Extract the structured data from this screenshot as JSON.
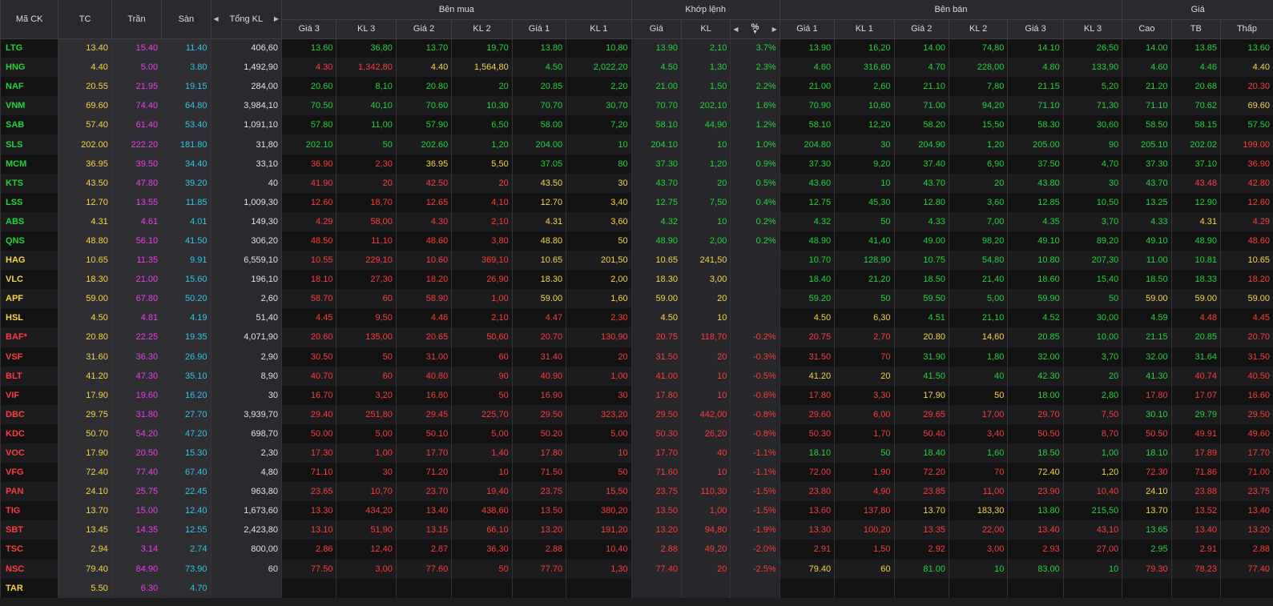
{
  "headers": {
    "symbol": "Mã CK",
    "ref": "TC",
    "ceil": "Trần",
    "floor": "Sàn",
    "total_vol": "Tổng KL",
    "buy_group": "Bên mua",
    "match_group": "Khớp lệnh",
    "sell_group": "Bên bán",
    "price_group": "Giá",
    "buy_cols": [
      "Giá 3",
      "KL 3",
      "Giá 2",
      "KL 2",
      "Giá 1",
      "KL 1"
    ],
    "match_cols": [
      "Giá",
      "KL",
      "%"
    ],
    "sell_cols": [
      "Giá 1",
      "KL 1",
      "Giá 2",
      "KL 2",
      "Giá 3",
      "KL 3"
    ],
    "price_cols": [
      "Cao",
      "TB",
      "Thấp"
    ]
  },
  "icons": {
    "left": "caret-left-icon",
    "right": "caret-right-icon",
    "sort": "sort-down-icon"
  },
  "colors": {
    "up": "#23d33c",
    "down": "#ff3b3b",
    "ref": "#f5d547",
    "ceil": "#f03cf0",
    "floor": "#2ec4f0"
  },
  "rows": [
    [
      "LTG",
      "13.40",
      "15.40",
      "11.40",
      "406,60",
      "13.60",
      "36,80",
      "13.70",
      "19,70",
      "13.80",
      "10,80",
      "13.90",
      "2,10",
      "3.7%",
      "13.90",
      "16,20",
      "14.00",
      "74,80",
      "14.10",
      "26,50",
      "14.00",
      "13.85",
      "13.60"
    ],
    [
      "HNG",
      "4.40",
      "5.00",
      "3.80",
      "1,492,90",
      "4.30",
      "1,342,80",
      "4.40",
      "1,564,80",
      "4.50",
      "2,022,20",
      "4.50",
      "1,30",
      "2.3%",
      "4.60",
      "316,60",
      "4.70",
      "228,00",
      "4.80",
      "133,90",
      "4.60",
      "4.46",
      "4.40"
    ],
    [
      "NAF",
      "20.55",
      "21.95",
      "19.15",
      "284,00",
      "20.60",
      "8,10",
      "20.80",
      "20",
      "20.85",
      "2,20",
      "21.00",
      "1,50",
      "2.2%",
      "21.00",
      "2,60",
      "21.10",
      "7,80",
      "21.15",
      "5,20",
      "21.20",
      "20.68",
      "20.30"
    ],
    [
      "VNM",
      "69.60",
      "74.40",
      "64.80",
      "3,984,10",
      "70.50",
      "40,10",
      "70.60",
      "10,30",
      "70.70",
      "30,70",
      "70.70",
      "202,10",
      "1.6%",
      "70.90",
      "10,60",
      "71.00",
      "94,20",
      "71.10",
      "71,30",
      "71.10",
      "70.62",
      "69.60"
    ],
    [
      "SAB",
      "57.40",
      "61.40",
      "53.40",
      "1,091,10",
      "57.80",
      "11,00",
      "57.90",
      "6,50",
      "58.00",
      "7,20",
      "58.10",
      "44,90",
      "1.2%",
      "58.10",
      "12,20",
      "58.20",
      "15,50",
      "58.30",
      "30,60",
      "58.50",
      "58.15",
      "57.50"
    ],
    [
      "SLS",
      "202.00",
      "222.20",
      "181.80",
      "31,80",
      "202.10",
      "50",
      "202.60",
      "1,20",
      "204.00",
      "10",
      "204.10",
      "10",
      "1.0%",
      "204.80",
      "30",
      "204.90",
      "1,20",
      "205.00",
      "90",
      "205.10",
      "202.02",
      "199.00"
    ],
    [
      "MCM",
      "36.95",
      "39.50",
      "34.40",
      "33,10",
      "36.90",
      "2,30",
      "36.95",
      "5,50",
      "37.05",
      "80",
      "37.30",
      "1,20",
      "0.9%",
      "37.30",
      "9,20",
      "37.40",
      "6,90",
      "37.50",
      "4,70",
      "37.30",
      "37.10",
      "36.90"
    ],
    [
      "KTS",
      "43.50",
      "47.80",
      "39.20",
      "40",
      "41.90",
      "20",
      "42.50",
      "20",
      "43.50",
      "30",
      "43.70",
      "20",
      "0.5%",
      "43.60",
      "10",
      "43.70",
      "20",
      "43.80",
      "30",
      "43.70",
      "43.48",
      "42.80"
    ],
    [
      "LSS",
      "12.70",
      "13.55",
      "11.85",
      "1,009,30",
      "12.60",
      "18,70",
      "12.65",
      "4,10",
      "12.70",
      "3,40",
      "12.75",
      "7,50",
      "0.4%",
      "12.75",
      "45,30",
      "12.80",
      "3,60",
      "12.85",
      "10,50",
      "13.25",
      "12.90",
      "12.60"
    ],
    [
      "ABS",
      "4.31",
      "4.61",
      "4.01",
      "149,30",
      "4.29",
      "58,00",
      "4.30",
      "2,10",
      "4.31",
      "3,60",
      "4.32",
      "10",
      "0.2%",
      "4.32",
      "50",
      "4.33",
      "7,00",
      "4.35",
      "3,70",
      "4.33",
      "4.31",
      "4.29"
    ],
    [
      "QNS",
      "48.80",
      "56.10",
      "41.50",
      "306,20",
      "48.50",
      "11,10",
      "48.60",
      "3,80",
      "48.80",
      "50",
      "48.90",
      "2,00",
      "0.2%",
      "48.90",
      "41,40",
      "49.00",
      "98,20",
      "49.10",
      "89,20",
      "49.10",
      "48.90",
      "48.60"
    ],
    [
      "HAG",
      "10.65",
      "11.35",
      "9.91",
      "6,559,10",
      "10.55",
      "229,10",
      "10.60",
      "369,10",
      "10.65",
      "201,50",
      "10.65",
      "241,50",
      "",
      "10.70",
      "128,90",
      "10.75",
      "54,80",
      "10.80",
      "207,30",
      "11.00",
      "10.81",
      "10.65"
    ],
    [
      "VLC",
      "18.30",
      "21.00",
      "15.60",
      "196,10",
      "18.10",
      "27,30",
      "18.20",
      "26,90",
      "18.30",
      "2,00",
      "18.30",
      "3,00",
      "",
      "18.40",
      "21,20",
      "18.50",
      "21,40",
      "18.60",
      "15,40",
      "18.50",
      "18.33",
      "18.20"
    ],
    [
      "APF",
      "59.00",
      "67.80",
      "50.20",
      "2,60",
      "58.70",
      "60",
      "58.90",
      "1,00",
      "59.00",
      "1,60",
      "59.00",
      "20",
      "",
      "59.20",
      "50",
      "59.50",
      "5,00",
      "59.90",
      "50",
      "59.00",
      "59.00",
      "59.00"
    ],
    [
      "HSL",
      "4.50",
      "4.81",
      "4.19",
      "51,40",
      "4.45",
      "9,50",
      "4.46",
      "2,10",
      "4.47",
      "2,30",
      "4.50",
      "10",
      "",
      "4.50",
      "6,30",
      "4.51",
      "21,10",
      "4.52",
      "30,00",
      "4.59",
      "4.48",
      "4.45"
    ],
    [
      "BAF*",
      "20.80",
      "22.25",
      "19.35",
      "4,071,90",
      "20.60",
      "135,00",
      "20.65",
      "50,60",
      "20.70",
      "130,90",
      "20.75",
      "118,70",
      "-0.2%",
      "20.75",
      "2,70",
      "20.80",
      "14,60",
      "20.85",
      "10,00",
      "21.15",
      "20.85",
      "20.70"
    ],
    [
      "VSF",
      "31.60",
      "36.30",
      "26.90",
      "2,90",
      "30.50",
      "50",
      "31.00",
      "60",
      "31.40",
      "20",
      "31.50",
      "20",
      "-0.3%",
      "31.50",
      "70",
      "31.90",
      "1,80",
      "32.00",
      "3,70",
      "32.00",
      "31.64",
      "31.50"
    ],
    [
      "BLT",
      "41.20",
      "47.30",
      "35.10",
      "8,90",
      "40.70",
      "60",
      "40.80",
      "90",
      "40.90",
      "1,00",
      "41.00",
      "10",
      "-0.5%",
      "41.20",
      "20",
      "41.50",
      "40",
      "42.30",
      "20",
      "41.30",
      "40.74",
      "40.50"
    ],
    [
      "VIF",
      "17.90",
      "19.60",
      "16.20",
      "30",
      "16.70",
      "3,20",
      "16.80",
      "50",
      "16.90",
      "30",
      "17.80",
      "10",
      "-0.6%",
      "17.80",
      "3,30",
      "17.90",
      "50",
      "18.00",
      "2,80",
      "17.80",
      "17.07",
      "16.60"
    ],
    [
      "DBC",
      "29.75",
      "31.80",
      "27.70",
      "3,939,70",
      "29.40",
      "251,80",
      "29.45",
      "225,70",
      "29.50",
      "323,20",
      "29.50",
      "442,00",
      "-0.8%",
      "29.60",
      "6,00",
      "29.65",
      "17,00",
      "29.70",
      "7,50",
      "30.10",
      "29.79",
      "29.50"
    ],
    [
      "KDC",
      "50.70",
      "54.20",
      "47.20",
      "698,70",
      "50.00",
      "5,00",
      "50.10",
      "5,00",
      "50.20",
      "5,00",
      "50.30",
      "26,20",
      "-0.8%",
      "50.30",
      "1,70",
      "50.40",
      "3,40",
      "50.50",
      "8,70",
      "50.50",
      "49.91",
      "49.60"
    ],
    [
      "VOC",
      "17.90",
      "20.50",
      "15.30",
      "2,30",
      "17.30",
      "1,00",
      "17.70",
      "1,40",
      "17.80",
      "10",
      "17.70",
      "40",
      "-1.1%",
      "18.10",
      "50",
      "18.40",
      "1,60",
      "18.50",
      "1,00",
      "18.10",
      "17.89",
      "17.70"
    ],
    [
      "VFG",
      "72.40",
      "77.40",
      "67.40",
      "4,80",
      "71.10",
      "30",
      "71.20",
      "10",
      "71.50",
      "50",
      "71.60",
      "10",
      "-1.1%",
      "72.00",
      "1,90",
      "72.20",
      "70",
      "72.40",
      "1,20",
      "72.30",
      "71.86",
      "71.00"
    ],
    [
      "PAN",
      "24.10",
      "25.75",
      "22.45",
      "963,80",
      "23.65",
      "10,70",
      "23.70",
      "19,40",
      "23.75",
      "15,50",
      "23.75",
      "110,30",
      "-1.5%",
      "23.80",
      "4,90",
      "23.85",
      "11,00",
      "23.90",
      "10,40",
      "24.10",
      "23.88",
      "23.75"
    ],
    [
      "TIG",
      "13.70",
      "15.00",
      "12.40",
      "1,673,60",
      "13.30",
      "434,20",
      "13.40",
      "438,60",
      "13.50",
      "380,20",
      "13.50",
      "1,00",
      "-1.5%",
      "13.60",
      "137,80",
      "13.70",
      "183,30",
      "13.80",
      "215,50",
      "13.70",
      "13.52",
      "13.40"
    ],
    [
      "SBT",
      "13.45",
      "14.35",
      "12.55",
      "2,423,80",
      "13.10",
      "51,90",
      "13.15",
      "66,10",
      "13.20",
      "191,20",
      "13.20",
      "94,80",
      "-1.9%",
      "13.30",
      "100,20",
      "13.35",
      "22,00",
      "13.40",
      "43,10",
      "13.65",
      "13.40",
      "13.20"
    ],
    [
      "TSC",
      "2.94",
      "3.14",
      "2.74",
      "800,00",
      "2.86",
      "12,40",
      "2.87",
      "36,30",
      "2.88",
      "10,40",
      "2.88",
      "49,20",
      "-2.0%",
      "2.91",
      "1,50",
      "2.92",
      "3,00",
      "2.93",
      "27,00",
      "2.95",
      "2.91",
      "2.88"
    ],
    [
      "NSC",
      "79.40",
      "84.90",
      "73.90",
      "60",
      "77.50",
      "3,00",
      "77.60",
      "50",
      "77.70",
      "1,30",
      "77.40",
      "20",
      "-2.5%",
      "79.40",
      "60",
      "81.00",
      "10",
      "83.00",
      "10",
      "79.30",
      "78.23",
      "77.40"
    ],
    [
      "TAR",
      "5.50",
      "6.30",
      "4.70",
      "",
      "",
      "",
      "",
      "",
      "",
      "",
      "",
      "",
      "",
      "",
      "",
      "",
      "",
      "",
      "",
      "",
      "",
      ""
    ]
  ]
}
